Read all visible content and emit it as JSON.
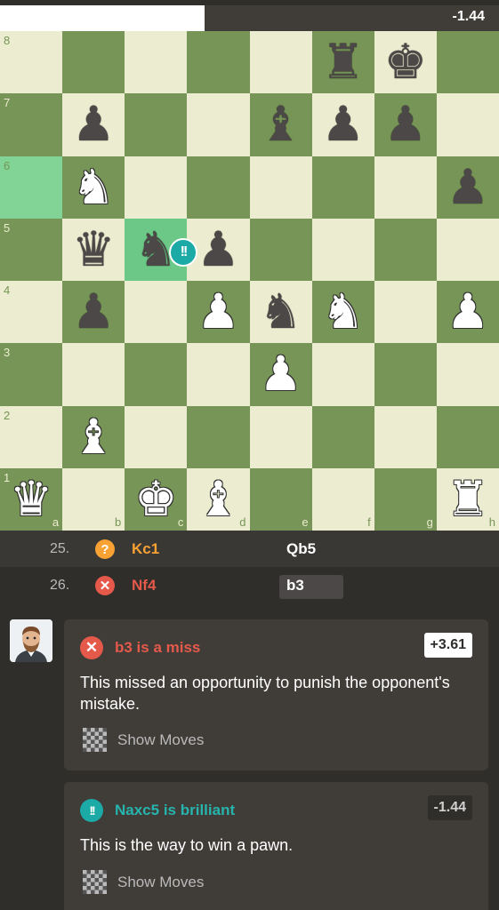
{
  "eval_bar": {
    "value": "-1.44",
    "white_fraction": 0.41
  },
  "board": {
    "files": [
      "a",
      "b",
      "c",
      "d",
      "e",
      "f",
      "g",
      "h"
    ],
    "ranks": [
      "8",
      "7",
      "6",
      "5",
      "4",
      "3",
      "2",
      "1"
    ],
    "highlighted_squares": [
      "a6",
      "c5"
    ],
    "brilliant_badge": {
      "square": "c5",
      "symbol": "!!"
    },
    "pieces": [
      {
        "sq": "f8",
        "color": "b",
        "type": "rook"
      },
      {
        "sq": "g8",
        "color": "b",
        "type": "king"
      },
      {
        "sq": "b7",
        "color": "b",
        "type": "pawn"
      },
      {
        "sq": "e7",
        "color": "b",
        "type": "bishop"
      },
      {
        "sq": "f7",
        "color": "b",
        "type": "pawn"
      },
      {
        "sq": "g7",
        "color": "b",
        "type": "pawn"
      },
      {
        "sq": "b6",
        "color": "w",
        "type": "knight"
      },
      {
        "sq": "h6",
        "color": "b",
        "type": "pawn"
      },
      {
        "sq": "b5",
        "color": "b",
        "type": "queen"
      },
      {
        "sq": "c5",
        "color": "b",
        "type": "knight"
      },
      {
        "sq": "d5",
        "color": "b",
        "type": "pawn"
      },
      {
        "sq": "b4",
        "color": "b",
        "type": "pawn"
      },
      {
        "sq": "d4",
        "color": "w",
        "type": "pawn"
      },
      {
        "sq": "e4",
        "color": "b",
        "type": "knight"
      },
      {
        "sq": "f4",
        "color": "w",
        "type": "knight"
      },
      {
        "sq": "h4",
        "color": "w",
        "type": "pawn"
      },
      {
        "sq": "e3",
        "color": "w",
        "type": "pawn"
      },
      {
        "sq": "b2",
        "color": "w",
        "type": "bishop"
      },
      {
        "sq": "a1",
        "color": "w",
        "type": "queen"
      },
      {
        "sq": "c1",
        "color": "w",
        "type": "king"
      },
      {
        "sq": "d1",
        "color": "w",
        "type": "bishop"
      },
      {
        "sq": "h1",
        "color": "w",
        "type": "rook"
      }
    ]
  },
  "moves": [
    {
      "number": "25.",
      "white_icon": "?",
      "white": "Kc1",
      "white_class": "mistake",
      "black": "Qb5"
    },
    {
      "number": "26.",
      "white_icon": "✕",
      "white": "Nf4",
      "white_class": "miss",
      "black": "b3"
    }
  ],
  "cards": [
    {
      "icon": "✕",
      "title": "b3 is a miss",
      "eval": "+3.61",
      "body": "This missed an opportunity to punish the opponent's mistake.",
      "show_moves": "Show Moves"
    },
    {
      "icon": "!!",
      "title": "Naxc5 is brilliant",
      "eval": "-1.44",
      "body": "This is the way to win a pawn.",
      "show_moves": "Show Moves"
    }
  ],
  "icons": {
    "avatar": "coach-avatar-icon",
    "show_moves": "checkerboard-icon"
  },
  "colors": {
    "light_square": "#ebecd0",
    "dark_square": "#779556",
    "brilliant": "#1baaa6",
    "miss": "#e5594b",
    "mistake": "#f7a233"
  }
}
